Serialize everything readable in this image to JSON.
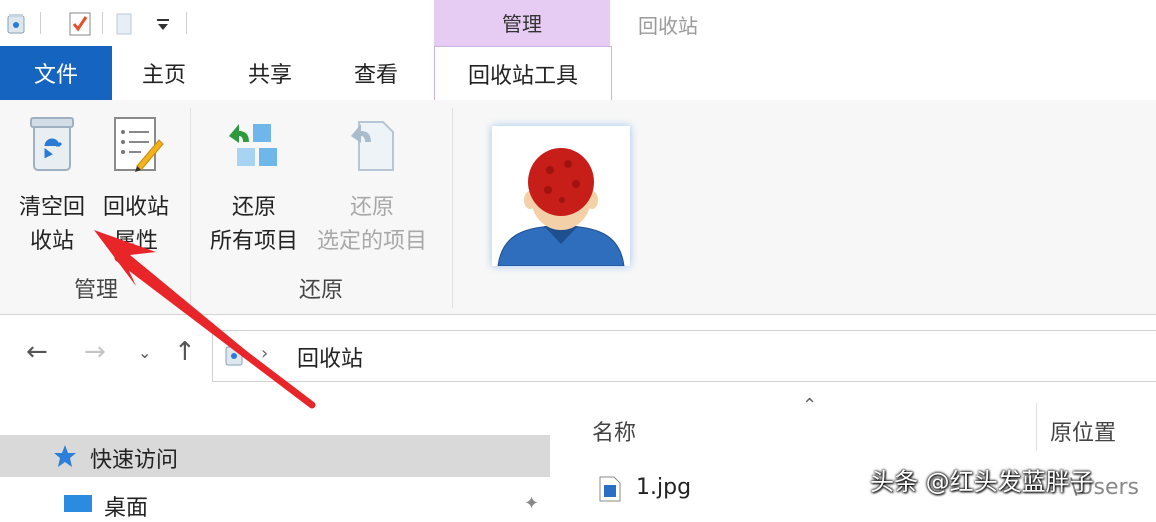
{
  "titlebar": {
    "context_group": "管理",
    "window_title": "回收站",
    "quick_access_icons": [
      "recycle-bin-small-icon",
      "properties-check-icon",
      "folder-icon",
      "customize-dropdown-icon"
    ]
  },
  "tabs": [
    {
      "label": "文件"
    },
    {
      "label": "主页"
    },
    {
      "label": "共享"
    },
    {
      "label": "查看"
    },
    {
      "label": "回收站工具"
    }
  ],
  "ribbon": {
    "empty_bin": {
      "line1": "清空回",
      "line2": "收站"
    },
    "bin_props": {
      "line1": "回收站",
      "line2": "属性"
    },
    "restore_all": {
      "line1": "还原",
      "line2": "所有项目"
    },
    "restore_selected": {
      "line1": "还原",
      "line2": "选定的项目"
    },
    "group_manage": "管理",
    "group_restore": "还原"
  },
  "address": {
    "path": "回收站"
  },
  "navpane": {
    "quick_access": "快速访问",
    "desktop": "桌面"
  },
  "filelist": {
    "col_name": "名称",
    "col_location": "原位置",
    "file_name": "1.jpg",
    "file_location": "\\Users"
  },
  "watermark": "头条 @红头发蓝胖子",
  "colors": {
    "file_tab": "#1565c0",
    "context_tab": "#e6ccf2",
    "annotation_arrow": "#e8262a",
    "ribbon_bg": "#f7f7f7"
  }
}
